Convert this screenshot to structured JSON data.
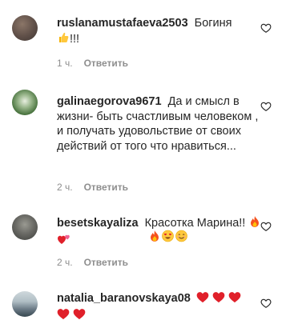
{
  "comments": [
    {
      "username": "ruslanamustafaeva2503",
      "text": "Богиня",
      "emoji_suffix": "!!!",
      "time": "1 ч.",
      "reply_label": "Ответить",
      "emojis": [
        "thumbs-up"
      ]
    },
    {
      "username": "galinaegorova9671",
      "text": "Да и смысл в жизни- быть счастливым человеком , и получать удовольствие от своих действий от того что нравиться...",
      "time": "2 ч.",
      "reply_label": "Ответить"
    },
    {
      "username": "besetskayaliza",
      "text": "Красотка Марина!!",
      "time": "2 ч.",
      "reply_label": "Ответить",
      "emojis": [
        "fire",
        "two-hearts",
        "fire",
        "heart-eyes",
        "smiling-face"
      ]
    },
    {
      "username": "natalia_baranovskaya08",
      "text": "",
      "emojis": [
        "red-heart",
        "red-heart",
        "red-heart",
        "red-heart",
        "red-heart"
      ]
    }
  ],
  "colors": {
    "text": "#262626",
    "meta": "#8e8e8e",
    "heart_red": "#e0202a"
  }
}
